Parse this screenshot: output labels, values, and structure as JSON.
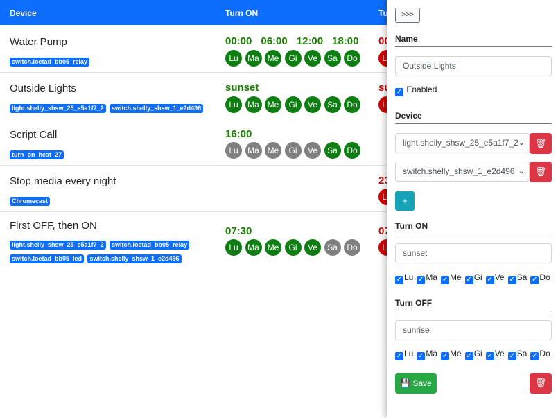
{
  "table": {
    "headers": {
      "device": "Device",
      "turn_on": "Turn ON",
      "turn_off": "Tu"
    },
    "rows": [
      {
        "name": "Water Pump",
        "entities": [
          "switch.loetad_bb05_relay"
        ],
        "on_times": [
          "00:00",
          "06:00",
          "12:00",
          "18:00"
        ],
        "on_days": [
          true,
          true,
          true,
          true,
          true,
          true,
          true
        ],
        "off_times": [
          "00"
        ],
        "off_days": [
          true,
          true,
          true,
          true,
          true,
          true,
          true
        ]
      },
      {
        "name": "Outside Lights",
        "entities": [
          "light.shelly_shsw_25_e5a1f7_2",
          "switch.shelly_shsw_1_e2d496"
        ],
        "on_times": [
          "sunset"
        ],
        "on_days": [
          true,
          true,
          true,
          true,
          true,
          true,
          true
        ],
        "off_times": [
          "su"
        ],
        "off_days": [
          true,
          true,
          true,
          true,
          true,
          true,
          true
        ]
      },
      {
        "name": "Script Call",
        "entities": [
          "turn_on_heat_27"
        ],
        "on_times": [
          "16:00"
        ],
        "on_days": [
          false,
          false,
          false,
          false,
          false,
          true,
          true
        ],
        "off_times": [],
        "off_days": []
      },
      {
        "name": "Stop media every night",
        "entities": [
          "Chromecast"
        ],
        "on_times": [],
        "on_days": [],
        "off_times": [
          "23"
        ],
        "off_days": [
          true,
          true,
          true,
          true,
          true,
          true,
          true
        ]
      },
      {
        "name": "First OFF, then ON",
        "entities": [
          "light.shelly_shsw_25_e5a1f7_2",
          "switch.loetad_bb05_relay",
          "switch.loetad_bb05_led",
          "switch.shelly_shsw_1_e2d496"
        ],
        "on_times": [
          "07:30"
        ],
        "on_days": [
          true,
          true,
          true,
          true,
          true,
          false,
          false
        ],
        "off_times": [
          "07"
        ],
        "off_days": [
          true,
          true,
          true,
          true,
          true,
          true,
          true
        ]
      }
    ],
    "day_labels": [
      "Lu",
      "Ma",
      "Me",
      "Gi",
      "Ve",
      "Sa",
      "Do"
    ]
  },
  "panel": {
    "toggle_label": ">>>",
    "name_title": "Name",
    "name_value": "Outside Lights",
    "enabled_label": "Enabled",
    "enabled": true,
    "device_title": "Device",
    "devices": [
      "light.shelly_shsw_25_e5a1f7_2",
      "switch.shelly_shsw_1_e2d496"
    ],
    "add_label": "+",
    "turn_on_title": "Turn ON",
    "turn_on_value": "sunset",
    "turn_off_title": "Turn OFF",
    "turn_off_value": "sunrise",
    "day_labels": [
      "Lu",
      "Ma",
      "Me",
      "Gi",
      "Ve",
      "Sa",
      "Do"
    ],
    "save_label": "Save"
  },
  "colors": {
    "primary": "#0d6efd",
    "on_day": "#0e7d12",
    "off_day": "#d60000",
    "inactive_day": "#808080",
    "danger": "#dc3545",
    "success": "#28a745",
    "info": "#17a2b8"
  }
}
